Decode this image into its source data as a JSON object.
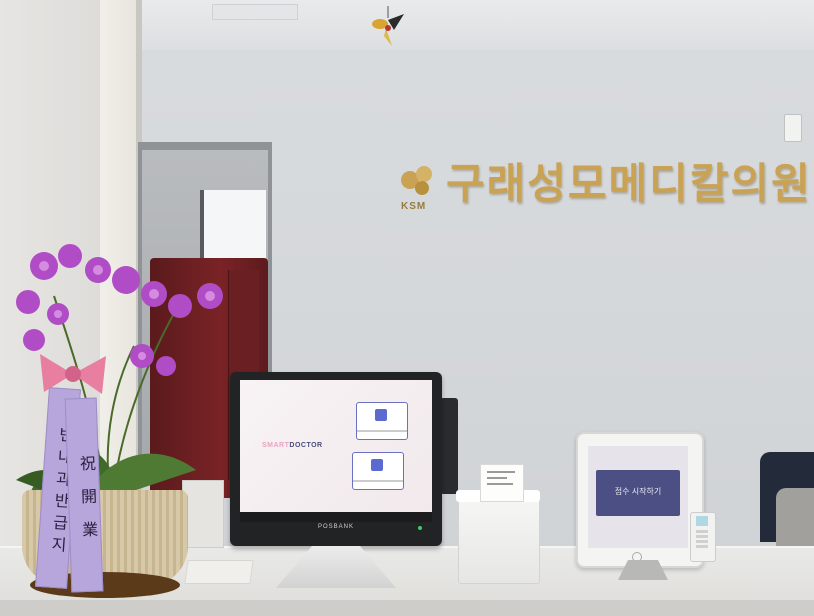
{
  "scene": {
    "description_type": "photo",
    "signage": {
      "logo_text": "KSM",
      "clinic_name": "구래성모메디칼의원",
      "color": "#c9a253"
    },
    "kiosk": {
      "app_name_part1": "SMART",
      "app_name_part2": "DOCTOR",
      "brand": "POSBANK",
      "screen_color": "#f4eef1"
    },
    "tablet": {
      "button_label": "접수 시작하기",
      "button_color": "#4c4f84"
    },
    "ribbon": {
      "left_text": "반내과반급지",
      "right_text": "祝 開 業"
    }
  }
}
